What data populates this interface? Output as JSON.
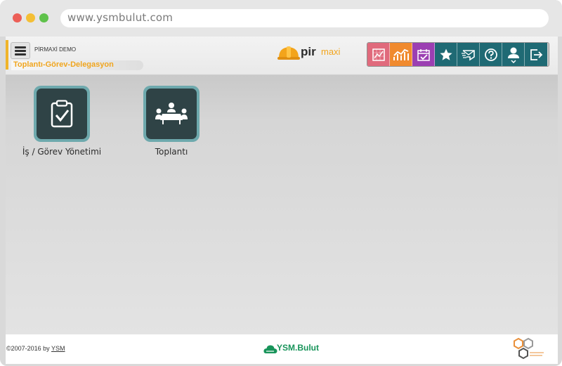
{
  "browser": {
    "url": "www.ysmbulut.com"
  },
  "header": {
    "company": "PİRMAXİ DEMO",
    "module_title": "Toplantı-Görev-Delegasyon",
    "logo": {
      "pir": "pir",
      "maxi": "maxi"
    }
  },
  "toolbar": {
    "buttons": [
      {
        "icon": "report-icon",
        "color": "#e06a7c"
      },
      {
        "icon": "chart-icon",
        "color": "#f08a2e"
      },
      {
        "icon": "calendar-check-icon",
        "color": "#9b3fb2"
      },
      {
        "icon": "star-icon",
        "color": "#1f6a74"
      },
      {
        "icon": "message-icon",
        "color": "#1f6a74"
      },
      {
        "icon": "help-icon",
        "color": "#1f6a74"
      },
      {
        "icon": "user-icon",
        "color": "#1f6a74"
      },
      {
        "icon": "logout-icon",
        "color": "#1f6a74"
      }
    ]
  },
  "tiles": [
    {
      "label": "İş / Görev Yönetimi",
      "icon": "clipboard-check-icon"
    },
    {
      "label": "Toplantı",
      "icon": "meeting-icon"
    }
  ],
  "footer": {
    "copyright_prefix": "©2007-2016 by ",
    "copyright_link": "YSM",
    "brand": "YSM.Bulut"
  },
  "colors": {
    "accent": "#f0b429",
    "tile_border": "#6ea9ad",
    "tile_fill": "#2f4346",
    "brand_green": "#18945a"
  }
}
